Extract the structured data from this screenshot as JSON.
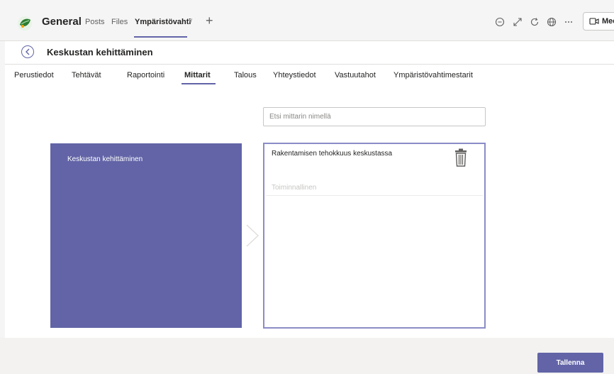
{
  "header": {
    "channel": "General",
    "tabs": [
      {
        "label": "Posts"
      },
      {
        "label": "Files"
      },
      {
        "label": "Ympäristövahti"
      }
    ],
    "meet_label": "Mee"
  },
  "page": {
    "title": "Keskustan kehittäminen"
  },
  "subtabs": [
    {
      "label": "Perustiedot"
    },
    {
      "label": "Tehtävät"
    },
    {
      "label": "Raportointi"
    },
    {
      "label": "Mittarit"
    },
    {
      "label": "Talous"
    },
    {
      "label": "Yhteystiedot"
    },
    {
      "label": "Vastuutahot"
    },
    {
      "label": "Ympäristövahtimestarit"
    }
  ],
  "search": {
    "placeholder": "Etsi mittarin nimellä",
    "value": ""
  },
  "project_card": {
    "label": "Keskustan kehittäminen"
  },
  "indicator": {
    "name": "Rakentamisen tehokkuus keskustassa",
    "status": "Toiminnallinen"
  },
  "footer": {
    "save_label": "Tallenna"
  },
  "colors": {
    "accent": "#6264a7",
    "panel_border": "#8b8cc7"
  }
}
